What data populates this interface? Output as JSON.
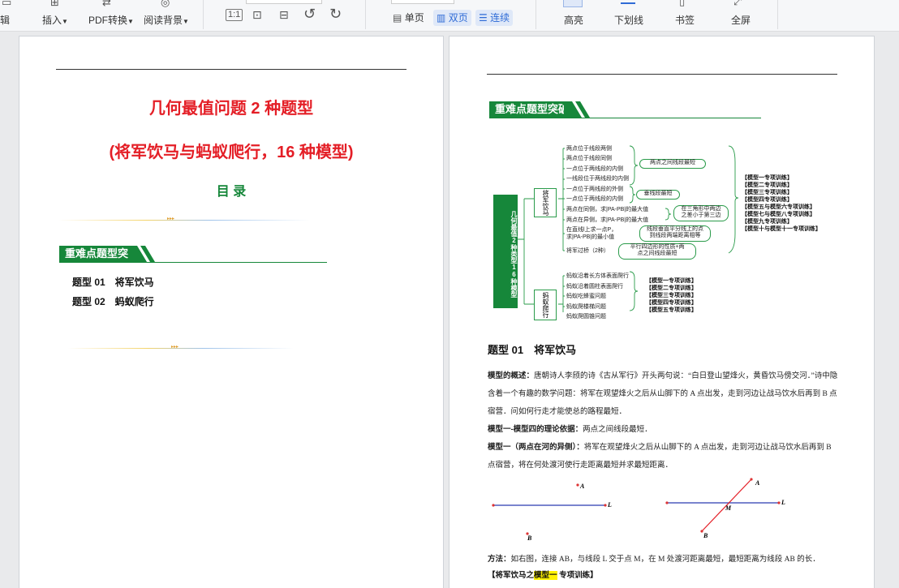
{
  "toolbar": {
    "edit_label": "辑",
    "insert_label": "插入",
    "pdf_label": "PDF转换",
    "bg_label": "阅读背景",
    "single_label": "单页",
    "double_label": "双页",
    "continuous_label": "连续",
    "highlight_label": "高亮",
    "underline_label": "下划线",
    "bookmark_label": "书签",
    "fullscreen_label": "全屏"
  },
  "left_page": {
    "title": "几何最值问题 2 种题型",
    "subtitle": "(将军饮马与蚂蚁爬行，16 种模型)",
    "toc_title": "目 录",
    "band_label": "重难点题型突破",
    "toc_items": [
      "题型 01　将军饮马",
      "题型 02　蚂蚁爬行"
    ]
  },
  "right_page": {
    "band_label": "重难点题型突破",
    "mindmap": {
      "root": "几何最值2种类型16种模型",
      "branch1": "将军饮马",
      "branch2": "蚂蚁爬行",
      "b1_items": [
        "两点位于线段两侧",
        "两点位于线段同侧",
        "一点位于两线段的内侧",
        "一线段位于两线段的内侧",
        "一点位于两线段的外侧",
        "一点位于两线段的内侧",
        "两点在同侧，求|PA-PB|的最大值",
        "两点在异侧，求|PA-PB|的最大值",
        "在直线l上求一点P，",
        "求|PA-PB|的最小值",
        "将军过桥（2种）"
      ],
      "b1_boxes": [
        "两点之间线段最短",
        "垂线段最短",
        "在三角形中两边",
        "之差小于第三边",
        "线段垂直平分线上的点",
        "到线段两端距离相等",
        "平行四边形的性质+两",
        "点之间线段最短"
      ],
      "b1_brackets": [
        "【模型一专项训练】",
        "【模型二专项训练】",
        "【模型三专项训练】",
        "【模型四专项训练】",
        "【模型五与模型六专项训练】",
        "【模型七与模型八专项训练】",
        "【模型九专项训练】",
        "【模型十与模型十一专项训练】"
      ],
      "b2_items": [
        "蚂蚁沿着长方体表面爬行",
        "蚂蚁沿着圆柱表面爬行",
        "蚂蚁吃蜂蜜问题",
        "蚂蚁爬楼梯问题",
        "蚂蚁爬圆锥问题"
      ],
      "b2_brackets": [
        "【模型一专项训练】",
        "【模型二专项训练】",
        "【模型三专项训练】",
        "【模型四专项训练】",
        "【模型五专项训练】"
      ]
    },
    "section_title": "题型 01　将军饮马",
    "p1_label": "模型的概述：",
    "p1_text": "唐朝诗人李颀的诗《古从军行》开头两句说：“白日登山望烽火，黄昏饮马傍交河．”诗中隐含着一个有趣的数学问题：将军在观望烽火之后从山脚下的 A 点出发，走到河边让战马饮水后再到 B 点宿营．问如何行走才能使总的路程最短．",
    "p2_label": "模型一-模型四的理论依据：",
    "p2_text": "两点之间线段最短．",
    "p3_label": "模型一（两点在河的异侧）：",
    "p3_text": "将军在观望烽火之后从山脚下的 A 点出发，走到河边让战马饮水后再到 B 点宿营，将在何处渡河使行走距离最短并求最短距离．",
    "fig_labels": {
      "A": "A",
      "B": "B",
      "L": "L",
      "M": "M"
    },
    "method_label": "方法：",
    "method_text": "如右图，连接 AB，与线段 L 交于点 M，在 M 处渡河距离最短，最短距离为线段 AB 的长．",
    "training_prefix": "【将军饮马之",
    "training_highlight": "模型一",
    "training_suffix": " 专项训练】",
    "colors": {
      "green": "#16873a",
      "red": "#e41e26",
      "highlight": "#fff200"
    }
  }
}
